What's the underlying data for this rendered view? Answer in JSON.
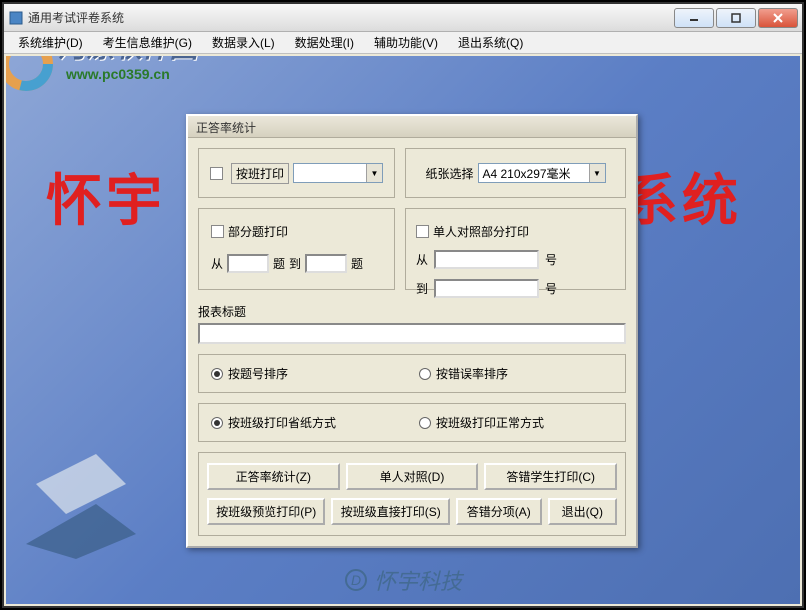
{
  "window": {
    "title": "通用考试评卷系统"
  },
  "menu": {
    "m1": "系统维护(D)",
    "m2": "考生信息维护(G)",
    "m3": "数据录入(L)",
    "m4": "数据处理(I)",
    "m5": "辅助功能(V)",
    "m6": "退出系统(Q)"
  },
  "watermark": {
    "brand": "河漂软件园",
    "url": "www.pc0359.cn",
    "bgtext_left": "怀宇",
    "bgtext_right": "系统",
    "bottom": "怀宇科技"
  },
  "dialog": {
    "title": "正答率统计",
    "chk_byclass": "按班打印",
    "paper_label": "纸张选择",
    "paper_value": "A4 210x297毫米",
    "chk_partial": "部分题打印",
    "from": "从",
    "ti": "题",
    "to": "到",
    "chk_single": "单人对照部分打印",
    "from2": "从",
    "hao": "号",
    "to2": "到",
    "hao2": "号",
    "report_title_label": "报表标题",
    "r_sort1": "按题号排序",
    "r_sort2": "按错误率排序",
    "r_mode1": "按班级打印省纸方式",
    "r_mode2": "按班级打印正常方式",
    "btn1": "正答率统计(Z)",
    "btn2": "单人对照(D)",
    "btn3": "答错学生打印(C)",
    "btn4": "按班级预览打印(P)",
    "btn5": "按班级直接打印(S)",
    "btn6": "答错分项(A)",
    "btn7": "退出(Q)"
  }
}
